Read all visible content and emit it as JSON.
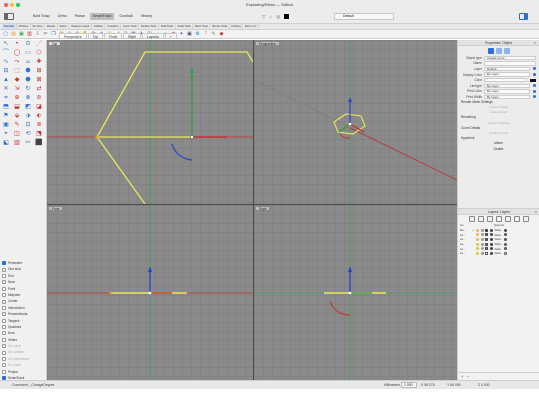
{
  "window": {
    "title": "Exploding/Rhino — Edited",
    "tabs": [
      "Bold Snap",
      "Ortho",
      "Planar",
      "SmartTrack",
      "Gumball",
      "History"
    ],
    "active_tab_index": 3,
    "layer_combo": "Default"
  },
  "ribbon_tabs": [
    "Standard",
    "CPlanes",
    "Set View",
    "Display",
    "Select",
    "Viewport Layout",
    "Visibility",
    "Transform",
    "Curve Tools",
    "Surface Tools",
    "Solid Tools",
    "SubD Tools",
    "Mesh Tools",
    "Render Tools",
    "Drafting",
    "New in V7"
  ],
  "toolbar_icons": [
    "new-icon",
    "open-icon",
    "save-icon",
    "print-icon",
    "import-icon",
    "cut-icon",
    "copy-icon",
    "paste-icon",
    "undo-icon",
    "redo-icon",
    "pan-icon",
    "rotate-view-icon",
    "zoom-icon",
    "zoom-window-icon",
    "zoom-extents-icon",
    "zoom-selected-icon",
    "grid-icon",
    "sun-icon",
    "layer-icon",
    "shade-icon",
    "render-icon",
    "materials-icon",
    "light-icon",
    "object-props-icon",
    "options-icon",
    "help-icon",
    "pen-icon",
    "blue-drop-icon"
  ],
  "viewport_tabs": [
    "Perspective",
    "Top",
    "Front",
    "Right",
    "Layouts"
  ],
  "viewport_tab_add": "+",
  "viewports": {
    "top": "Top",
    "perspective": "Perspective",
    "front": "Front",
    "right": "Right"
  },
  "osnap": {
    "items": [
      {
        "label": "Persistent",
        "checked": true,
        "dim": false
      },
      {
        "label": "One shot",
        "checked": false,
        "dim": false
      },
      {
        "label": "End",
        "checked": false,
        "dim": false
      },
      {
        "label": "Near",
        "checked": false,
        "dim": false
      },
      {
        "label": "Point",
        "checked": false,
        "dim": false
      },
      {
        "label": "Midpoint",
        "checked": false,
        "dim": false
      },
      {
        "label": "Center",
        "checked": false,
        "dim": false
      },
      {
        "label": "Intersection",
        "checked": false,
        "dim": false
      },
      {
        "label": "Perpendicular",
        "checked": false,
        "dim": false
      },
      {
        "label": "Tangent",
        "checked": false,
        "dim": false
      },
      {
        "label": "Quadrant",
        "checked": false,
        "dim": false
      },
      {
        "label": "Knot",
        "checked": false,
        "dim": false
      },
      {
        "label": "Vertex",
        "checked": false,
        "dim": false
      },
      {
        "label": "On curve",
        "checked": false,
        "dim": true
      },
      {
        "label": "On surface",
        "checked": false,
        "dim": true
      },
      {
        "label": "On polysurface",
        "checked": false,
        "dim": true
      },
      {
        "label": "On mesh",
        "checked": false,
        "dim": true
      },
      {
        "label": "Project",
        "checked": false,
        "dim": false
      },
      {
        "label": "SmartTrack",
        "checked": true,
        "dim": false
      },
      {
        "label": "Disable all",
        "checked": false,
        "dim": false
      }
    ]
  },
  "properties": {
    "title": "Properties: Object",
    "rows": [
      {
        "label": "Object type",
        "value": "Closed curve",
        "disabled": false
      },
      {
        "label": "Name",
        "value": "",
        "disabled": false
      },
      {
        "label": "Layer",
        "value": "Default",
        "disabled": false,
        "dot": true
      },
      {
        "label": "Display Color",
        "value": "By Layer",
        "disabled": false,
        "dot": true
      },
      {
        "label": "Color",
        "value": "",
        "disabled": true,
        "swatch": "#111111"
      },
      {
        "label": "Linetype",
        "value": "By Layer",
        "disabled": false,
        "dot": true
      },
      {
        "label": "Print Color",
        "value": "By Layer",
        "disabled": false,
        "dot": true
      },
      {
        "label": "Print Width",
        "value": "By Layer",
        "disabled": false,
        "dot": true
      }
    ],
    "section_render_mesh": "Render Mesh Settings",
    "render_mesh_buttons": [
      "Custom Mesh",
      "Adjust Mesh"
    ],
    "section_rendering": "Rendering",
    "rendering_buttons": [
      "Custom Settings"
    ],
    "section_curve_details": "Curve Details",
    "curve_details_buttons": [
      "Control Points"
    ],
    "section_hyperlink": "Hyperlink",
    "buttons": [
      "Match",
      "Details"
    ]
  },
  "layers": {
    "title": "Layers: Layers",
    "header": [
      "Na",
      "Material"
    ],
    "rows": [
      {
        "name": "De...",
        "check": "✓",
        "color": "#111111",
        "mat": "Defa..."
      },
      {
        "name": "La...",
        "check": "",
        "color": "#cc2222",
        "mat": "Defa..."
      },
      {
        "name": "La...",
        "check": "",
        "color": "#6a2a9a",
        "mat": "Defa..."
      },
      {
        "name": "La...",
        "check": "",
        "color": "#2e9d3d",
        "mat": "Defa..."
      },
      {
        "name": "La...",
        "check": "",
        "color": "#2357c9",
        "mat": "Defa..."
      },
      {
        "name": "La...",
        "check": "",
        "color": "#ffffff",
        "mat": "Defa..."
      }
    ]
  },
  "status": {
    "command": "Command: _ChangeDegree",
    "units": "Millimeters",
    "snap_value": "1.000",
    "x": "X 98.278",
    "y": "Y 66.095",
    "z": "Z 0.000"
  },
  "colors": {
    "accent": "#2d6fd9",
    "viewport_bg": "#8a8a8a",
    "curve": "#e8e85a",
    "x_axis": "#c43030",
    "y_axis": "#2ea24a"
  }
}
